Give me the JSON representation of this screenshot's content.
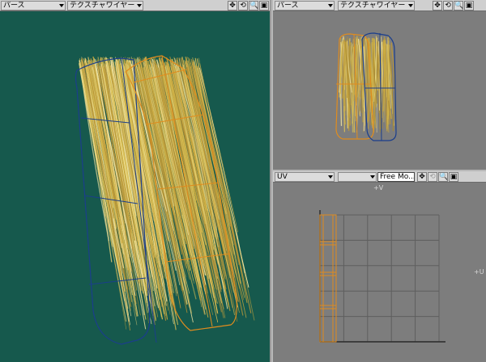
{
  "views": {
    "perspective": {
      "view_menu": "パース",
      "display_menu": "テクスチャワイヤー",
      "buttons": [
        "✥",
        "⟲",
        "🔍",
        "▣"
      ]
    },
    "top_right": {
      "view_menu": "パース",
      "display_menu": "テクスチャワイヤー",
      "buttons": [
        "✥",
        "⟲",
        "🔍",
        "▣"
      ]
    },
    "uv": {
      "view_menu": "UV",
      "map_field": "Free Mo...",
      "buttons": [
        "✥",
        "⟲",
        "🔍",
        "▣"
      ],
      "axis_v": "+V",
      "axis_u": "+U"
    }
  },
  "colors": {
    "perspective_bg": "#16594d",
    "view_bg": "#7d7d7d",
    "cage_blue": "#1b3e8c",
    "cage_orange": "#e08c1e",
    "hair": "#d1b54a",
    "uv_grid": "#5e5e5e"
  },
  "icons": [
    "move-view-icon",
    "rotate-view-icon",
    "zoom-view-icon",
    "maximize-view-icon"
  ]
}
